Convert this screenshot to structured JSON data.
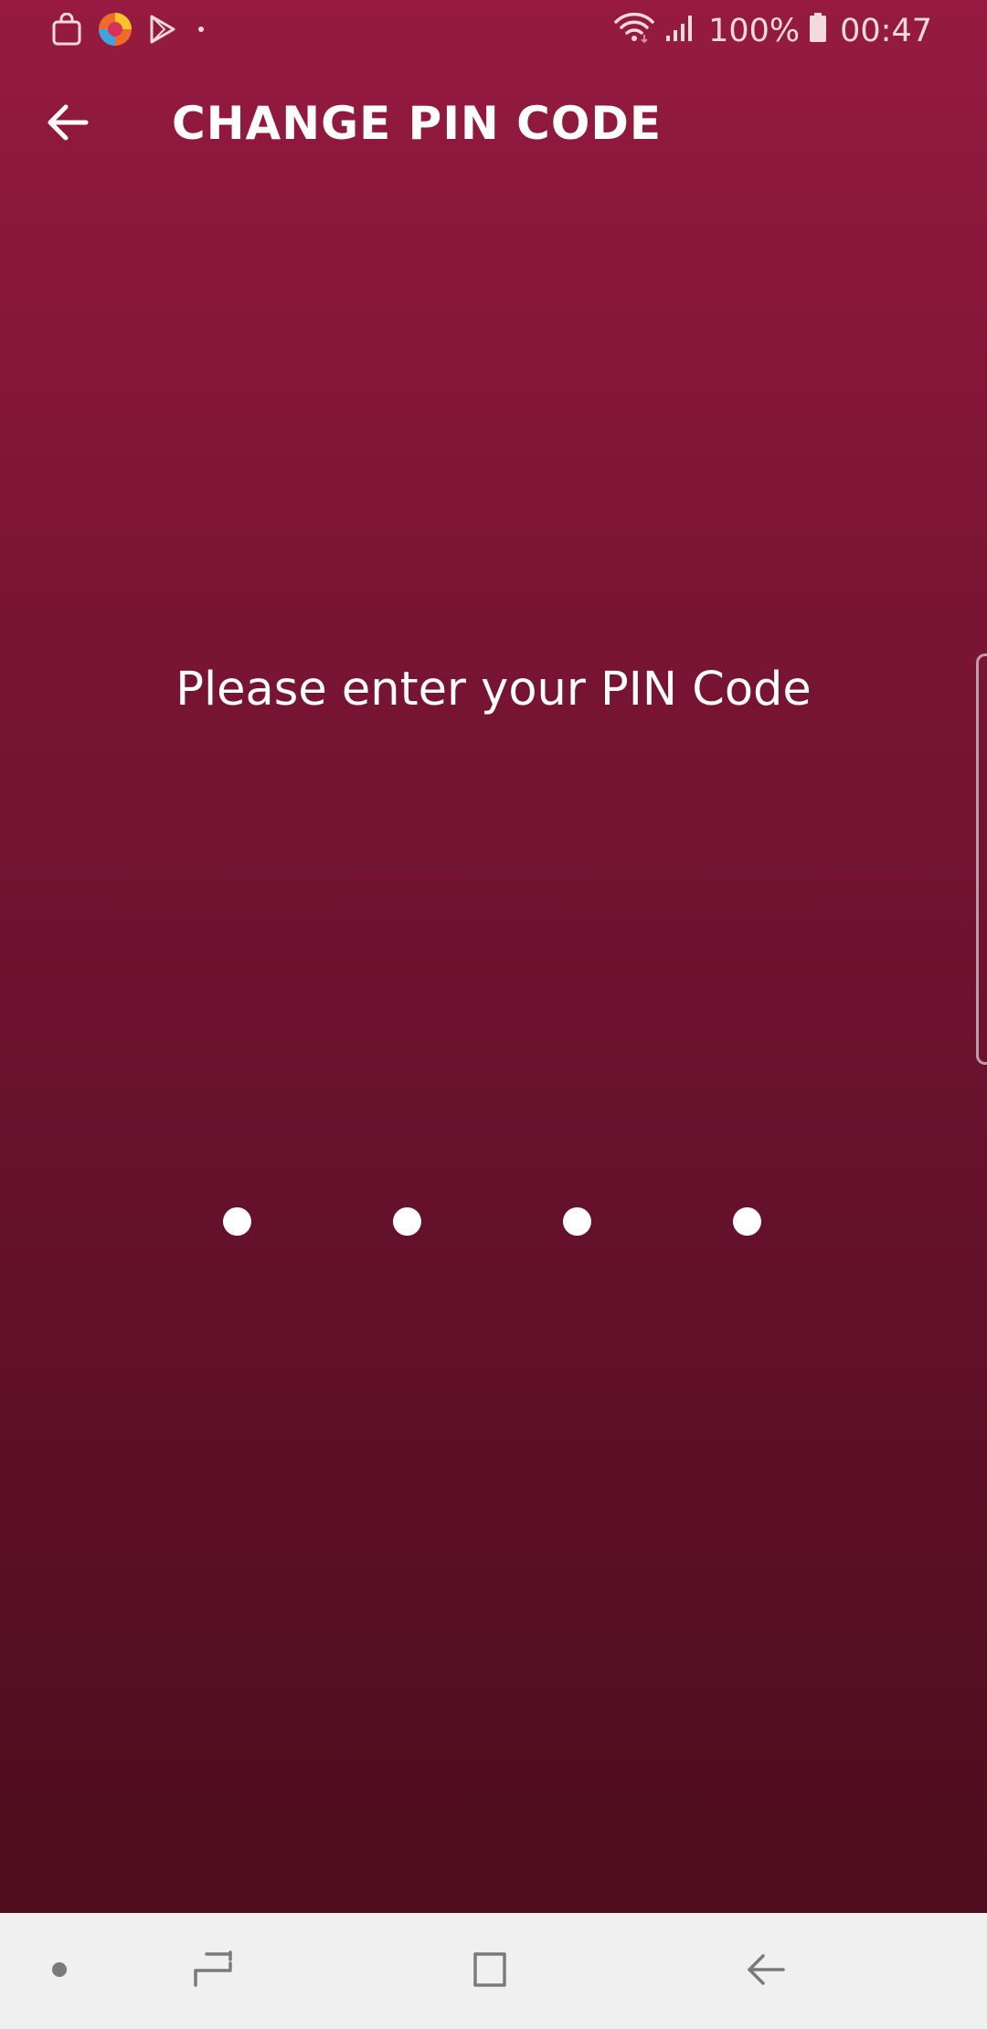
{
  "status_bar": {
    "battery_percent": "100%",
    "time": "00:47",
    "icons": [
      "shopping-bag-icon",
      "browser-app-icon",
      "play-store-icon",
      "notification-dot-icon",
      "wifi-icon",
      "cellular-signal-icon",
      "battery-icon"
    ]
  },
  "app_bar": {
    "title": "CHANGE PIN CODE",
    "back_icon": "arrow-left-icon"
  },
  "main": {
    "prompt": "Please enter your PIN Code",
    "pin_length": 4,
    "digits_entered": 0
  },
  "nav_bar": {
    "icons": [
      "nav-dot-icon",
      "recent-apps-icon",
      "home-icon",
      "back-icon"
    ]
  },
  "colors": {
    "background_top": "#961a41",
    "background_bottom": "#4a0d1b",
    "text": "#ffffff",
    "nav_bar": "#f0f0f0",
    "nav_icon": "#7a7a7a"
  }
}
